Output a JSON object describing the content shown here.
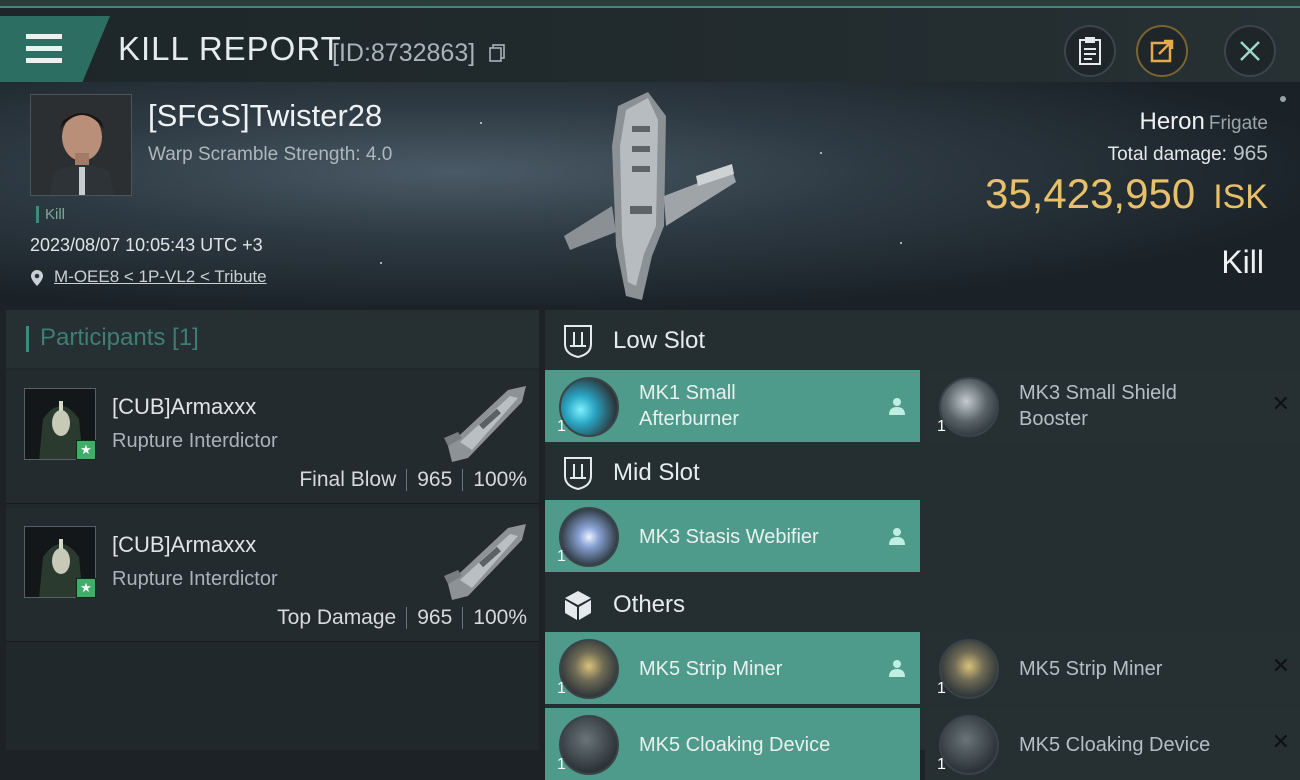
{
  "header": {
    "title": "KILL REPORT",
    "report_id": "[ID:8732863]",
    "buttons": [
      "clipboard-icon",
      "share-icon",
      "close-icon"
    ]
  },
  "victim": {
    "name": "[SFGS]Twister28",
    "warp_scramble": "Warp Scramble Strength: 4.0",
    "tag": "Kill",
    "datetime": "2023/08/07 10:05:43 UTC +3",
    "location": "M-OEE8 < 1P-VL2 < Tribute",
    "ship_name": "Heron",
    "ship_class": "Frigate",
    "total_damage_label": "Total damage:",
    "total_damage": "965",
    "isk_value": "35,423,950",
    "isk_unit": "ISK",
    "result": "Kill"
  },
  "participants": {
    "title": "Participants [1]",
    "items": [
      {
        "name": "[CUB]Armaxxx",
        "ship": "Rupture Interdictor",
        "role": "Final Blow",
        "damage": "965",
        "percent": "100%"
      },
      {
        "name": "[CUB]Armaxxx",
        "ship": "Rupture Interdictor",
        "role": "Top Damage",
        "damage": "965",
        "percent": "100%"
      }
    ]
  },
  "slots": {
    "low": {
      "title": "Low Slot",
      "modules": [
        {
          "name_line1": "MK1 Small",
          "name_line2": "Afterburner",
          "qty": "1"
        },
        {
          "name_line1": "MK3 Small Shield",
          "name_line2": "Booster",
          "qty": "1"
        }
      ]
    },
    "mid": {
      "title": "Mid Slot",
      "modules": [
        {
          "name": "MK3 Stasis Webifier",
          "qty": "1"
        }
      ]
    },
    "others": {
      "title": "Others",
      "modules": [
        {
          "name": "MK5 Strip Miner",
          "qty": "1"
        },
        {
          "name": "MK5 Strip Miner",
          "qty": "1"
        },
        {
          "name": "MK5 Cloaking Device",
          "qty": "1"
        },
        {
          "name": "MK5 Cloaking Device",
          "qty": "1"
        }
      ]
    }
  },
  "colors": {
    "accent_teal": "#3f8a79",
    "module_green": "#4e9a8b",
    "isk_gold": "#e8c06a"
  }
}
